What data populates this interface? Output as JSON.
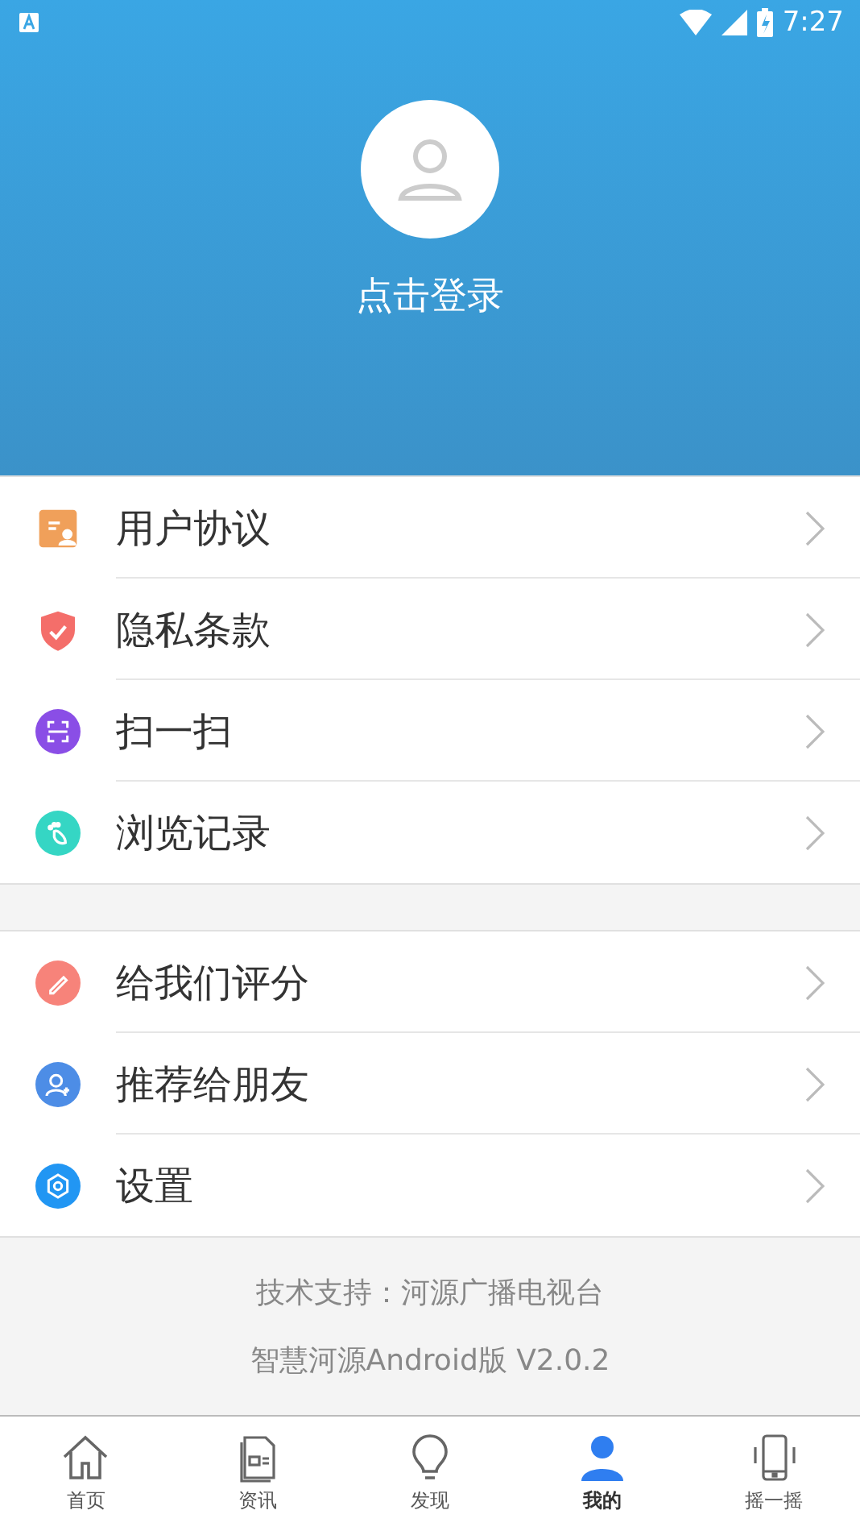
{
  "status_bar": {
    "time": "7:27"
  },
  "profile": {
    "login_label": "点击登录"
  },
  "menu_groups": [
    {
      "items": [
        {
          "label": "用户协议",
          "kind": "agreement",
          "color": "#f0a05a"
        },
        {
          "label": "隐私条款",
          "kind": "shield",
          "color": "#f46e6a"
        },
        {
          "label": "扫一扫",
          "kind": "scan",
          "color": "#8a4ee6"
        },
        {
          "label": "浏览记录",
          "kind": "footprint",
          "color": "#35d6c4"
        }
      ]
    },
    {
      "items": [
        {
          "label": "给我们评分",
          "kind": "pencil",
          "color": "#f7837a"
        },
        {
          "label": "推荐给朋友",
          "kind": "person",
          "color": "#4d8de6"
        },
        {
          "label": "设置",
          "kind": "gear",
          "color": "#2196f3"
        }
      ]
    }
  ],
  "footer": {
    "support": "技术支持：河源广播电视台",
    "version": "智慧河源Android版 V2.0.2"
  },
  "tabs": [
    {
      "label": "首页",
      "kind": "home",
      "selected": false
    },
    {
      "label": "资讯",
      "kind": "news",
      "selected": false
    },
    {
      "label": "发现",
      "kind": "bulb",
      "selected": false
    },
    {
      "label": "我的",
      "kind": "user",
      "selected": true
    },
    {
      "label": "摇一摇",
      "kind": "phone",
      "selected": false
    }
  ]
}
